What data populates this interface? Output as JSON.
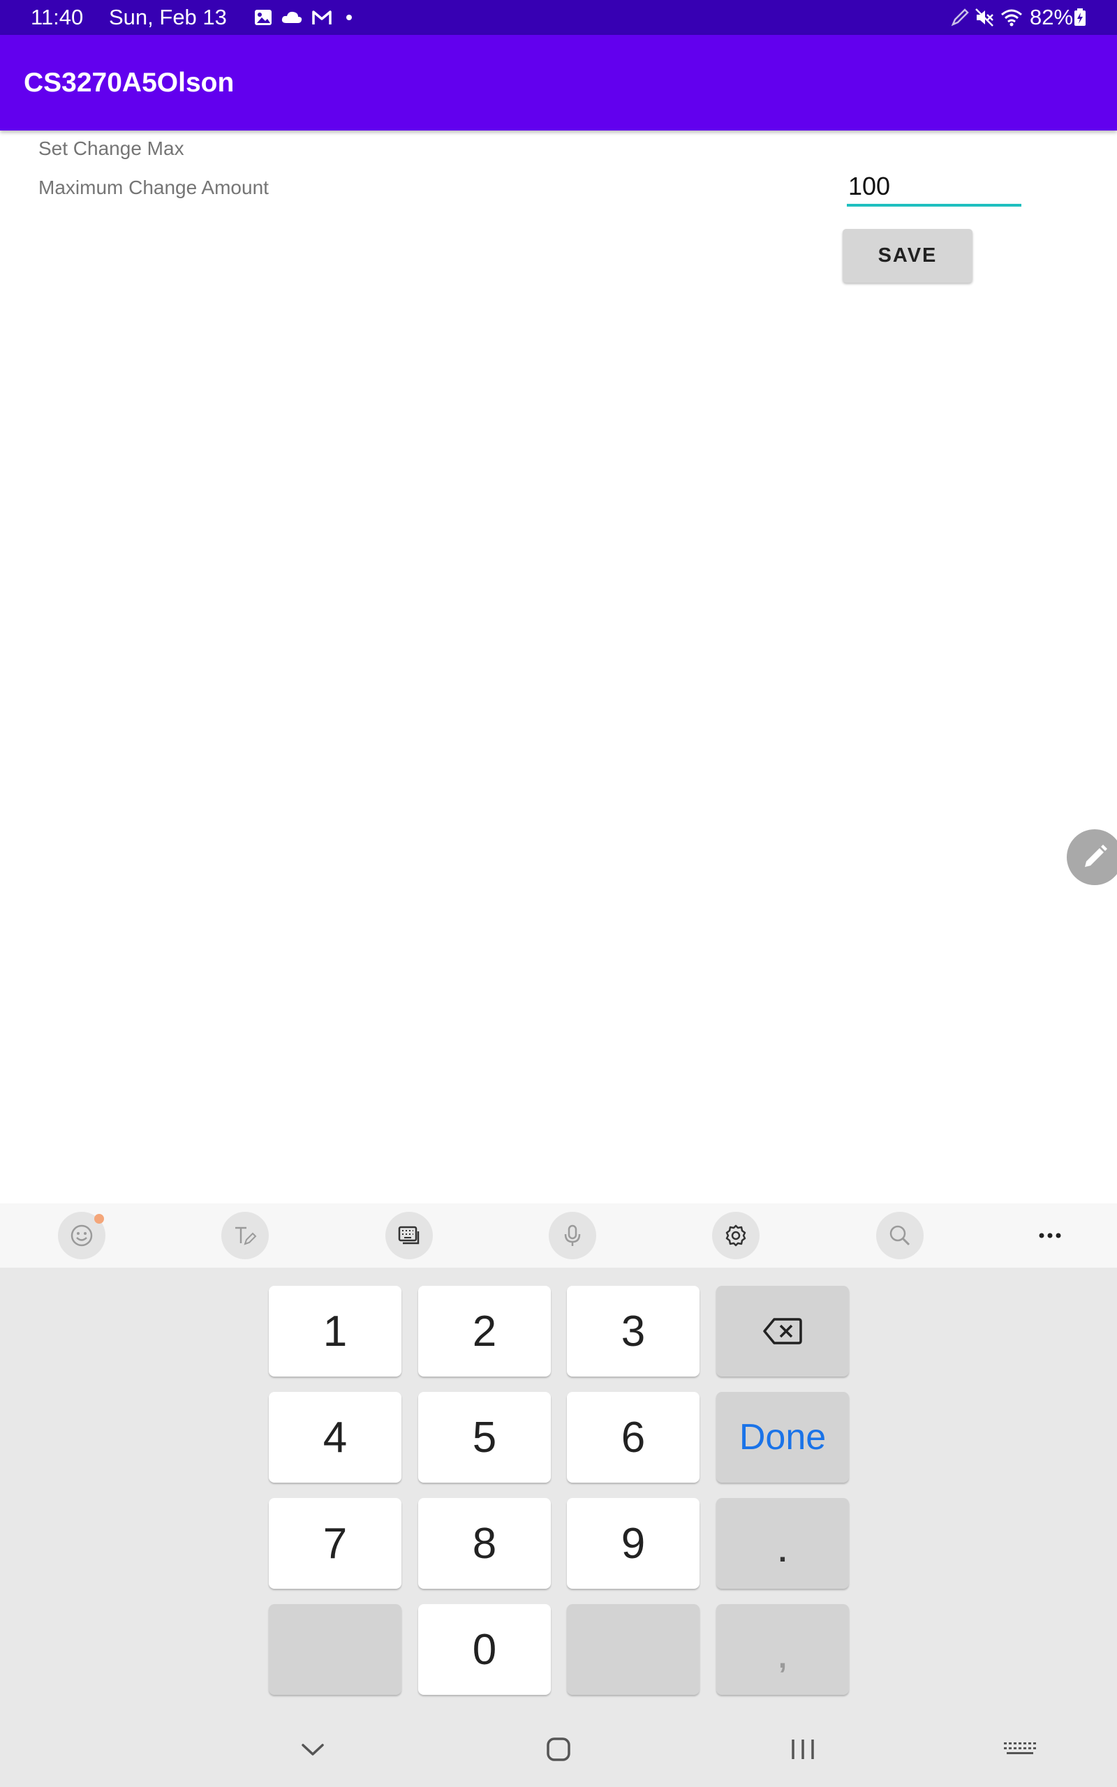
{
  "status_bar": {
    "time": "11:40",
    "date": "Sun, Feb 13",
    "battery": "82%",
    "icons": [
      "gallery-icon",
      "cloud-icon",
      "gmail-icon",
      "notification-dot-icon",
      "stylus-icon",
      "mute-icon",
      "wifi-icon",
      "battery-charging-icon"
    ],
    "background": "#3700b3"
  },
  "app_bar": {
    "title": "CS3270A5Olson",
    "background": "#6200ee"
  },
  "main": {
    "section_title": "Set Change Max",
    "field_label": "Maximum Change Amount",
    "amount_value": "100",
    "save_label": "SAVE",
    "input_underline_color": "#1fbfbf"
  },
  "keyboard_toolbar": {
    "icons": [
      "emoji-icon",
      "handwriting-icon",
      "keyboard-mode-icon",
      "microphone-icon",
      "settings-icon",
      "search-icon",
      "more-icon"
    ]
  },
  "keypad": {
    "keys": [
      "1",
      "2",
      "3",
      "backspace",
      "4",
      "5",
      "6",
      "Done",
      "7",
      "8",
      "9",
      ".",
      "",
      "0",
      "",
      ","
    ],
    "done_color": "#1a73e8"
  },
  "nav_bar": {
    "icons": [
      "hide-keyboard-icon",
      "home-icon",
      "recents-icon",
      "keyboard-switch-icon"
    ]
  }
}
